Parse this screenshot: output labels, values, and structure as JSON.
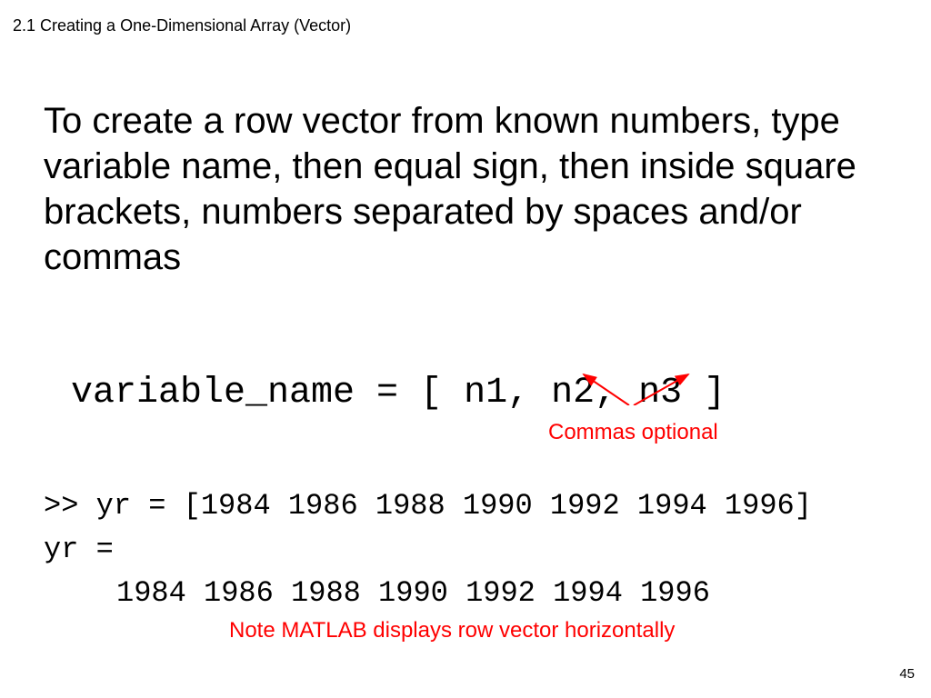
{
  "header": {
    "title": "2.1 Creating a One-Dimensional Array (Vector)"
  },
  "main": {
    "description": "To create a row vector from known numbers, type variable name, then equal sign, then inside square brackets, numbers separated by spaces and/or commas",
    "syntax": "variable_name = [ n1, n2, n3 ]",
    "annotation1": "Commas optional",
    "example_input": ">> yr = [1984 1986 1988 1990 1992 1994 1996]",
    "example_output_line1": "yr =",
    "example_output_line2": "1984 1986 1988 1990 1992 1994 1996",
    "annotation2": "Note MATLAB displays row vector horizontally"
  },
  "footer": {
    "page_number": "45"
  }
}
